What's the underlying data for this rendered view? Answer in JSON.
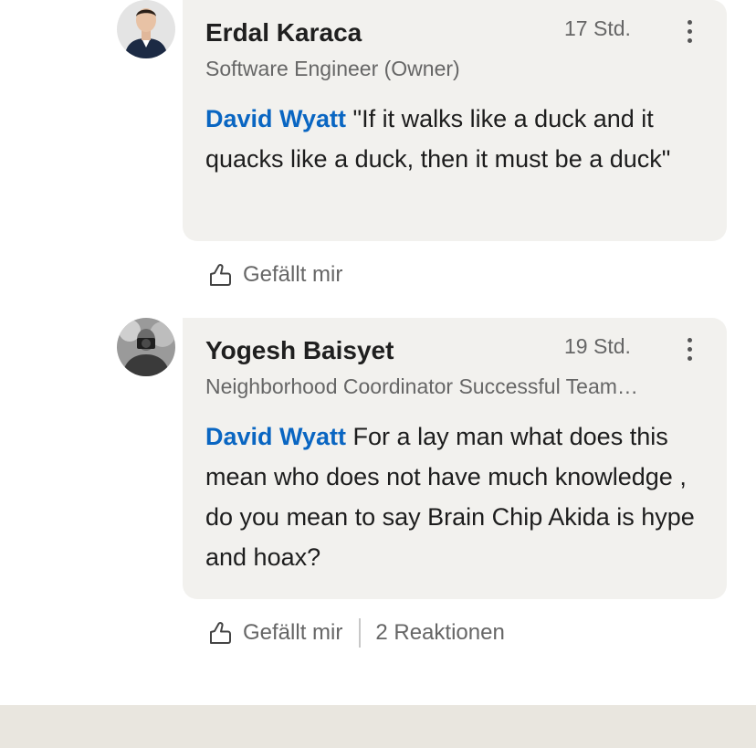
{
  "comments": [
    {
      "name": "Erdal Karaca",
      "headline": "Software Engineer (Owner)",
      "time": "17 Std.",
      "mention": "David Wyatt",
      "text": " \"If it walks like a duck and it quacks like a duck, then it must be a duck\"",
      "like_label": "Gefällt mir"
    },
    {
      "name": "Yogesh Baisyet",
      "headline": "Neighborhood Coordinator Successful Team…",
      "time": "19 Std.",
      "mention": "David Wyatt",
      "text": " For a lay man what does this mean who does not have much knowledge , do you mean to say Brain Chip Akida is hype and hoax?",
      "like_label": "Gefällt mir",
      "reactions": "2 Reaktionen"
    }
  ],
  "colors": {
    "mention": "#0a66c2",
    "bubble": "#f2f1ee",
    "footer": "#e9e6df"
  },
  "icons": [
    "thumbs-up-icon",
    "more-options-icon"
  ]
}
